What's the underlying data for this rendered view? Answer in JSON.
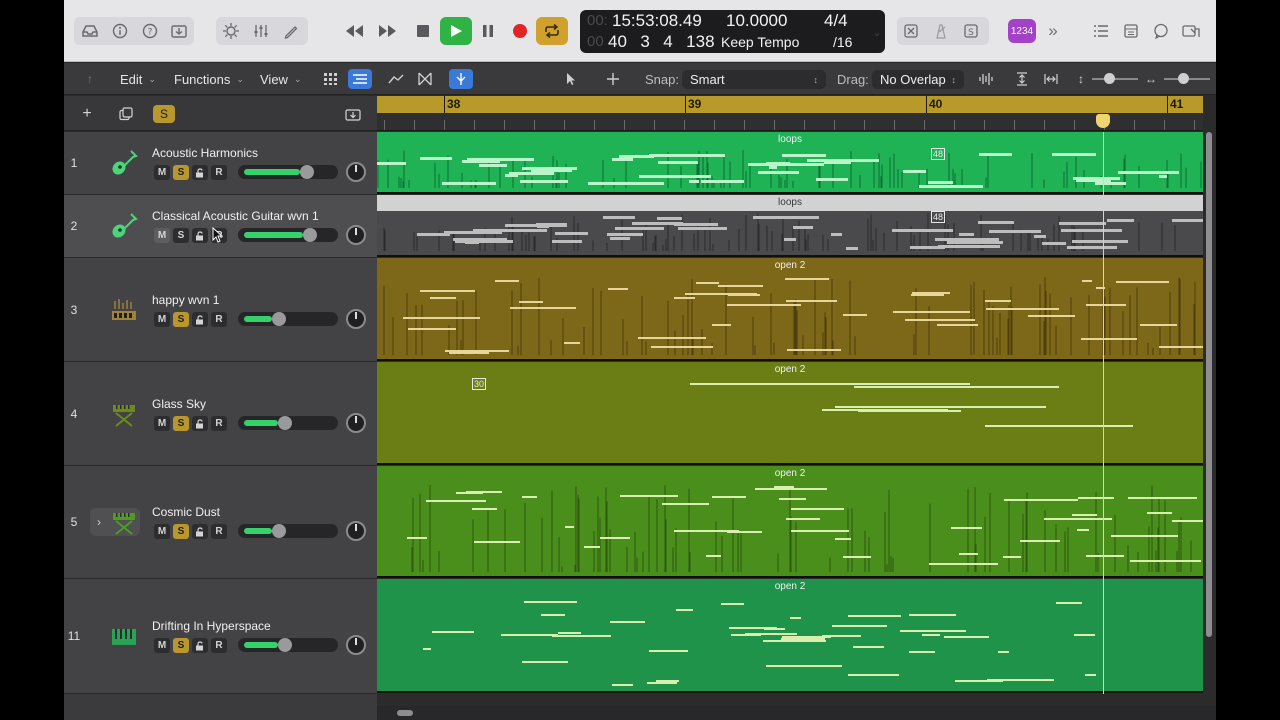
{
  "control_bar": {
    "lcd": {
      "time": "15:53:08.49",
      "time_ghost": "00:",
      "bars": "40  3  4  138",
      "bars_ghost": "00",
      "tempo": "10.0000",
      "tempo_mode": "Keep Tempo",
      "signature": "4/4",
      "division": "/16"
    },
    "count_in": "1234"
  },
  "toolbar": {
    "edit_label": "Edit",
    "functions_label": "Functions",
    "view_label": "View",
    "snap_label": "Snap:",
    "snap_value": "Smart",
    "drag_label": "Drag:",
    "drag_value": "No Overlap"
  },
  "ruler": {
    "bars": [
      "38",
      "39",
      "40",
      "41"
    ]
  },
  "header_tools": {
    "solo_label": "S"
  },
  "tracks": [
    {
      "number": "1",
      "name": "Acoustic Harmonics",
      "instrument_icon": "guitar-icon",
      "mute": "M",
      "solo": "S",
      "record": "R",
      "volume": 0.72,
      "region": {
        "name": "loops",
        "overlay_label": "48",
        "color": "#1fb356"
      }
    },
    {
      "number": "2",
      "name": "Classical Acoustic Guitar wvn 1",
      "instrument_icon": "guitar-icon",
      "mute": "M",
      "solo": "S",
      "record": "R",
      "volume": 0.75,
      "region": {
        "name": "loops",
        "overlay_label": "48",
        "color": "#4a4a4c"
      }
    },
    {
      "number": "3",
      "name": "happy wvn 1",
      "instrument_icon": "drum-machine-icon",
      "mute": "M",
      "solo": "S",
      "record": "R",
      "volume": 0.4,
      "region": {
        "name": "open 2",
        "color": "#7d6718"
      }
    },
    {
      "number": "4",
      "name": "Glass Sky",
      "instrument_icon": "keyboard-stand-icon",
      "mute": "M",
      "solo": "S",
      "record": "R",
      "volume": 0.46,
      "region": {
        "name": "open 2",
        "overlay_label": "30",
        "color": "#6b7e16"
      }
    },
    {
      "number": "5",
      "name": "Cosmic Dust",
      "instrument_icon": "keyboard-stand-icon",
      "mute": "M",
      "solo": "S",
      "record": "R",
      "volume": 0.4,
      "region": {
        "name": "open 2",
        "color": "#4a8f1c"
      }
    },
    {
      "number": "11",
      "name": "Drifting In Hyperspace",
      "instrument_icon": "synth-icon",
      "mute": "M",
      "solo": "S",
      "record": "R",
      "volume": 0.47,
      "region": {
        "name": "open 2",
        "color": "#20934a"
      }
    }
  ]
}
